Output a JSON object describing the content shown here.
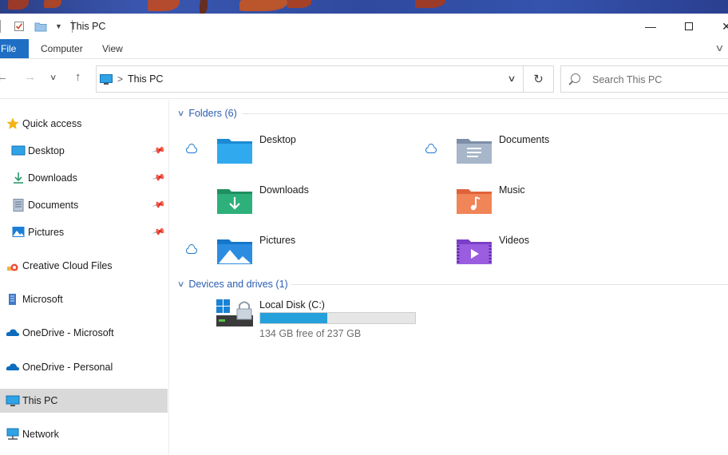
{
  "window": {
    "title": "This PC"
  },
  "ribbon": {
    "tabs": [
      "File",
      "Computer",
      "View"
    ]
  },
  "address": {
    "location": "This PC"
  },
  "search": {
    "placeholder": "Search This PC"
  },
  "sidebar": {
    "items": [
      {
        "label": "Quick access",
        "icon": "star-icon"
      },
      {
        "label": "Desktop",
        "icon": "desktop-icon",
        "pinned": true
      },
      {
        "label": "Downloads",
        "icon": "download-icon",
        "pinned": true
      },
      {
        "label": "Documents",
        "icon": "documents-icon",
        "pinned": true
      },
      {
        "label": "Pictures",
        "icon": "pictures-icon",
        "pinned": true
      },
      {
        "label": "Creative Cloud Files",
        "icon": "creative-cloud-icon"
      },
      {
        "label": "Microsoft",
        "icon": "building-icon"
      },
      {
        "label": "OneDrive - Microsoft",
        "icon": "onedrive-icon"
      },
      {
        "label": "OneDrive - Personal",
        "icon": "onedrive-icon"
      },
      {
        "label": "This PC",
        "icon": "computer-icon",
        "selected": true
      },
      {
        "label": "Network",
        "icon": "network-icon"
      }
    ]
  },
  "folders_group": {
    "header": "Folders (6)",
    "items": [
      {
        "label": "Desktop",
        "icon": "desktop-folder-icon",
        "cloud": true
      },
      {
        "label": "Documents",
        "icon": "documents-folder-icon",
        "cloud": true
      },
      {
        "label": "Downloads",
        "icon": "downloads-folder-icon",
        "cloud": false
      },
      {
        "label": "Music",
        "icon": "music-folder-icon",
        "cloud": false
      },
      {
        "label": "Pictures",
        "icon": "pictures-folder-icon",
        "cloud": true
      },
      {
        "label": "Videos",
        "icon": "videos-folder-icon",
        "cloud": false
      }
    ]
  },
  "drives_group": {
    "header": "Devices and drives (1)",
    "drive": {
      "label": "Local Disk (C:)",
      "free_text": "134 GB free of 237 GB",
      "used_fraction": 0.435
    }
  },
  "colors": {
    "accent": "#1e6fc4",
    "group_header": "#2a5db0",
    "selected": "#d9d9d9",
    "drive_fill": "#26a0da"
  }
}
